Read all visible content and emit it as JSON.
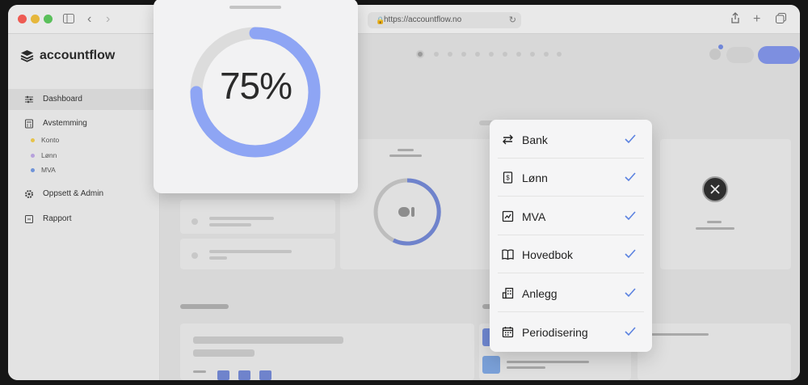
{
  "browser": {
    "url": "https://accountflow.no"
  },
  "app": {
    "name": "accountflow"
  },
  "sidebar": {
    "items": [
      {
        "label": "Dashboard",
        "icon": "sliders-icon",
        "active": true
      },
      {
        "label": "Avstemming",
        "icon": "calculator-icon",
        "active": false
      },
      {
        "label": "Oppsett & Admin",
        "icon": "gear-icon",
        "active": false
      },
      {
        "label": "Rapport",
        "icon": "report-icon",
        "active": false
      }
    ],
    "subitems": [
      {
        "label": "Konto",
        "color": "#e6c34a"
      },
      {
        "label": "Lønn",
        "color": "#b7a1dc"
      },
      {
        "label": "MVA",
        "color": "#6f93d8"
      }
    ]
  },
  "progress": {
    "label": "75%",
    "value": 0.75,
    "color": "#8ea5f4",
    "track_color": "#dcdcdc"
  },
  "menu": {
    "items": [
      {
        "label": "Bank",
        "icon": "transfer-arrows-icon",
        "checked": true
      },
      {
        "label": "Lønn",
        "icon": "payslip-icon",
        "checked": true
      },
      {
        "label": "MVA",
        "icon": "chart-icon",
        "checked": true
      },
      {
        "label": "Hovedbok",
        "icon": "book-icon",
        "checked": true
      },
      {
        "label": "Anlegg",
        "icon": "building-icon",
        "checked": true
      },
      {
        "label": "Periodisering",
        "icon": "calendar-icon",
        "checked": true
      }
    ],
    "check_color": "#5b82e0"
  },
  "colors": {
    "accent": "#7d8fe0"
  }
}
